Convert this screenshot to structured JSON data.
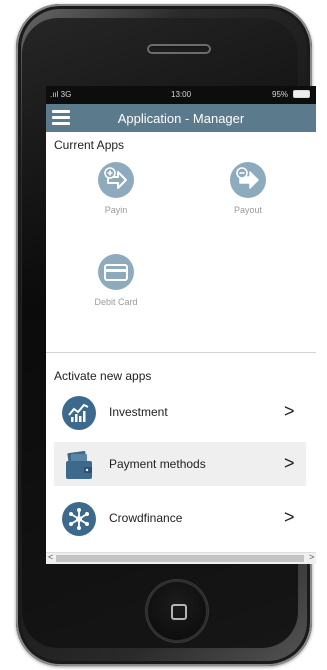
{
  "status_bar": {
    "signal": ".ııl 3G",
    "time": "13:00",
    "battery_pct": "95%",
    "battery_level": 0.95
  },
  "app_bar": {
    "title": "Application - Manager",
    "menu_icon": "hamburger-icon"
  },
  "current_apps": {
    "heading": "Current Apps",
    "apps": [
      {
        "label": "Payin",
        "icon": "payin-arrow-icon"
      },
      {
        "label": "Payout",
        "icon": "payout-arrow-icon"
      },
      {
        "label": "Debit Card",
        "icon": "card-icon"
      }
    ]
  },
  "new_apps": {
    "heading": "Activate new apps",
    "items": [
      {
        "label": "Investment",
        "icon": "chart-icon",
        "chevron": ">"
      },
      {
        "label": "Payment methods",
        "icon": "wallet-icon",
        "chevron": ">"
      },
      {
        "label": "Crowdfinance",
        "icon": "network-icon",
        "chevron": ">"
      }
    ]
  },
  "scrollbar": {
    "left": "<",
    "right": ">"
  },
  "colors": {
    "app_bar": "#5b7b8c",
    "tile_icon": "#8eaabd",
    "row_icon": "#3d6a8c",
    "highlight_row": "#efefef"
  }
}
